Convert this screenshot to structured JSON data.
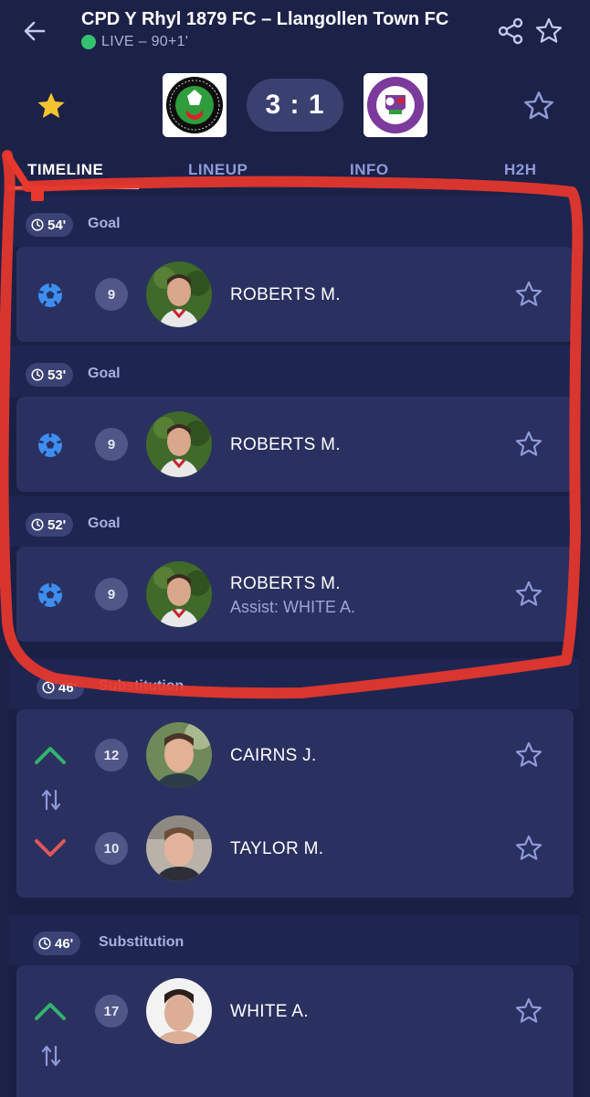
{
  "header": {
    "title": "CPD Y Rhyl 1879 FC – Llangollen Town FC",
    "live_status": "LIVE – 90+1'"
  },
  "score": {
    "display": "3 : 1",
    "home_crest_text": "CLWB PÊL DROED Y RHYL",
    "away_crest_text": "LLANGOLLEN TOWN FC",
    "away_crest_year": "1908"
  },
  "tabs": [
    {
      "label": "TIMELINE",
      "active": true
    },
    {
      "label": "LINEUP",
      "active": false
    },
    {
      "label": "INFO",
      "active": false
    },
    {
      "label": "H2H",
      "active": false
    }
  ],
  "events": [
    {
      "minute": "54'",
      "type": "Goal",
      "player": {
        "number": "9",
        "name": "ROBERTS M."
      }
    },
    {
      "minute": "53'",
      "type": "Goal",
      "player": {
        "number": "9",
        "name": "ROBERTS M."
      }
    },
    {
      "minute": "52'",
      "type": "Goal",
      "player": {
        "number": "9",
        "name": "ROBERTS M.",
        "assist": "Assist: WHITE A."
      }
    },
    {
      "minute": "46'",
      "type": "Substitution",
      "in": {
        "number": "12",
        "name": "CAIRNS J."
      },
      "out": {
        "number": "10",
        "name": "TAYLOR M."
      }
    },
    {
      "minute": "46'",
      "type": "Substitution",
      "in": {
        "number": "17",
        "name": "WHITE A."
      }
    }
  ],
  "colors": {
    "background": "#1c2148",
    "card": "#2a3060",
    "live": "#34c26e",
    "goal_icon": "#3d8ef0",
    "sub_in": "#33b36b",
    "sub_out": "#e3565a",
    "star_active": "#f4c430",
    "annotation": "#e8372c"
  },
  "icons": {
    "back": "arrow-left-icon",
    "share": "share-icon",
    "favorite": "star-icon",
    "goal": "soccer-ball-icon",
    "sub_in": "chevron-up-icon",
    "sub_out": "chevron-down-icon",
    "swap": "swap-arrows-icon",
    "clock": "clock-icon"
  }
}
